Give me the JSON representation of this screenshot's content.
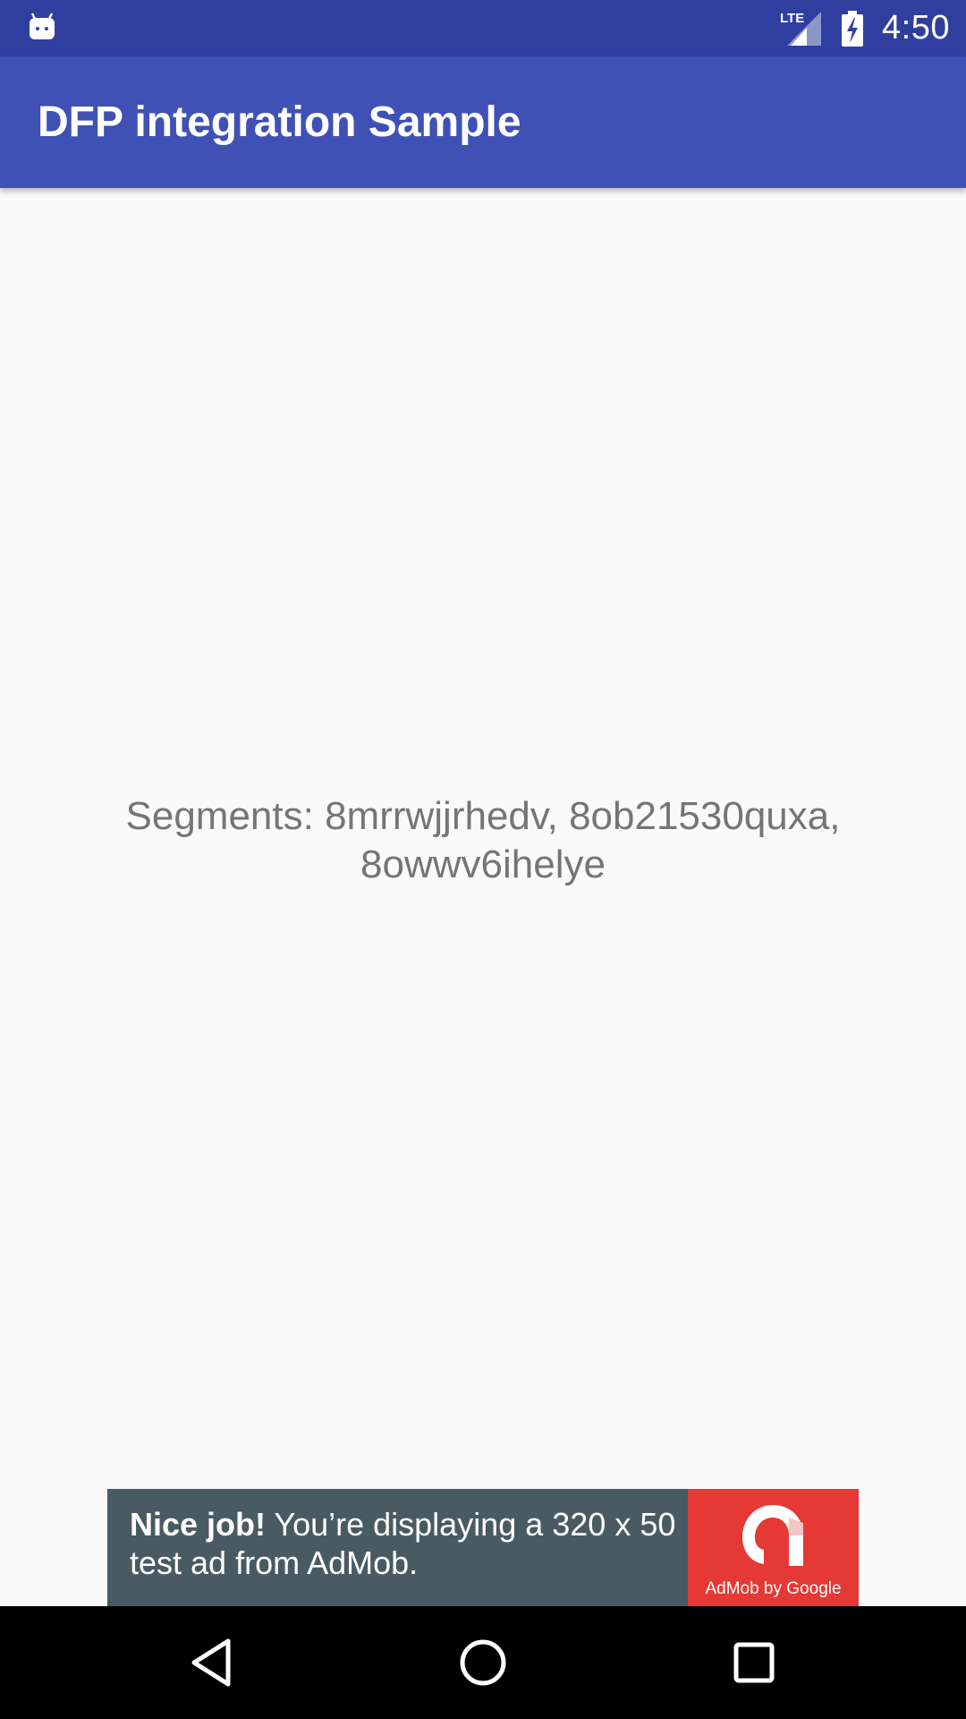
{
  "status_bar": {
    "time": "4:50",
    "network_label": "LTE",
    "icons": [
      "android-notification-icon",
      "lte-signal-icon",
      "battery-charging-icon"
    ]
  },
  "app_bar": {
    "title": "DFP integration Sample"
  },
  "content": {
    "segments_line1": "Segments: 8mrrwjjrhedv, 8ob21530quxa,",
    "segments_line2": "8owwv6ihelye"
  },
  "ad_banner": {
    "headline": "Nice job!",
    "body": " You’re displaying a 320 x 50 test ad from AdMob.",
    "logo_caption": "AdMob by Google",
    "colors": {
      "background": "#4a5a63",
      "logo_background": "#e53935"
    }
  },
  "nav_bar": {
    "buttons": [
      "back-icon",
      "home-icon",
      "recents-icon"
    ]
  },
  "colors": {
    "status_bar": "#303f9f",
    "app_bar": "#3f51b5",
    "content_background": "#fafafa",
    "text_secondary": "#757575"
  }
}
